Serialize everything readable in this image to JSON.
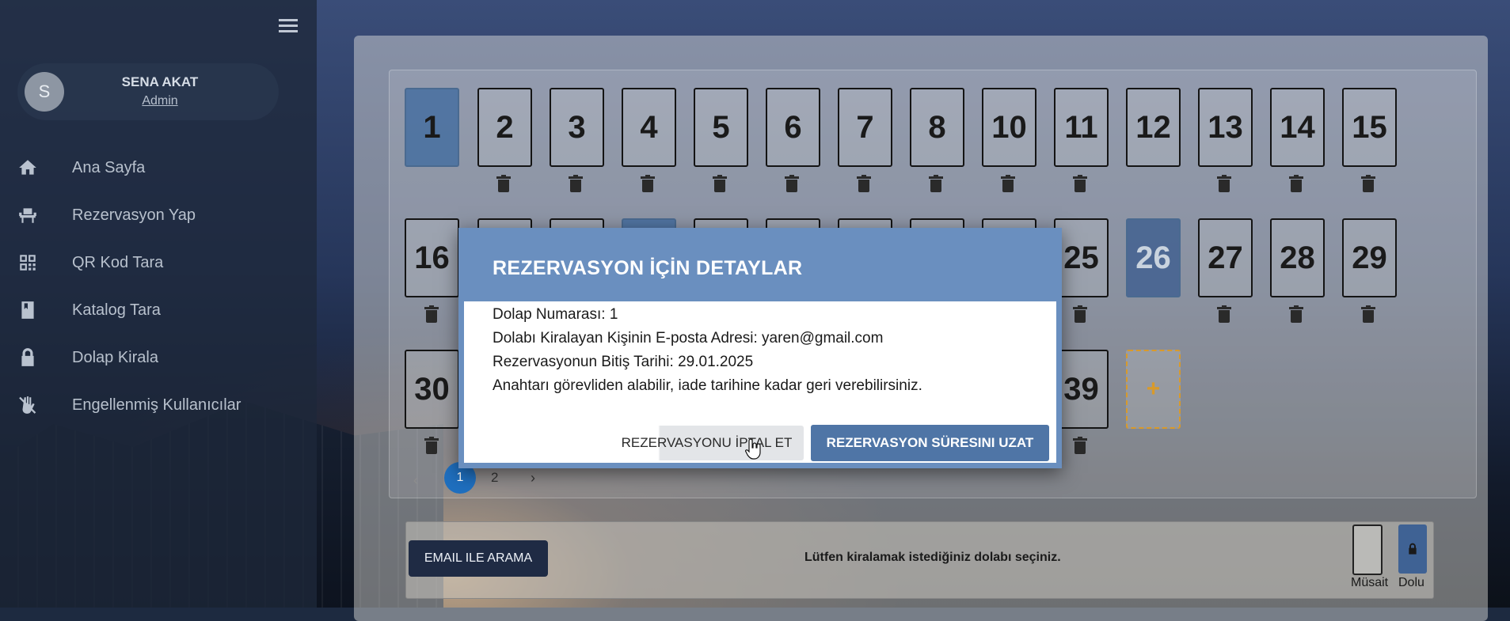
{
  "sidebar": {
    "user": {
      "initial": "S",
      "name": "SENA AKAT",
      "role": "Admin"
    },
    "items": [
      {
        "label": "Ana Sayfa",
        "icon": "home-icon"
      },
      {
        "label": "Rezervasyon Yap",
        "icon": "seat-icon"
      },
      {
        "label": "QR Kod Tara",
        "icon": "qr-code-icon"
      },
      {
        "label": "Katalog Tara",
        "icon": "book-icon"
      },
      {
        "label": "Dolap Kirala",
        "icon": "lock-icon"
      },
      {
        "label": "Engellenmiş Kullanıcılar",
        "icon": "blocked-hand-icon"
      }
    ]
  },
  "lockers": {
    "row1": [
      "1",
      "2",
      "3",
      "4",
      "5",
      "6",
      "7",
      "8",
      "10",
      "11",
      "12",
      "13",
      "14",
      "15"
    ],
    "row2_visible": [
      "16",
      "25",
      "26",
      "27",
      "28",
      "29"
    ],
    "row3_visible": [
      "30",
      "39"
    ],
    "add_label": "+",
    "selected": [
      "1",
      "26"
    ]
  },
  "pagination": {
    "prev": "‹",
    "pages": [
      "1",
      "2"
    ],
    "current": "1",
    "next": "›"
  },
  "bottom": {
    "email_button": "EMAIL ILE ARAMA",
    "message": "Lütfen kiralamak istediğiniz dolabı seçiniz.",
    "legend_free": "Müsait",
    "legend_full": "Dolu"
  },
  "modal": {
    "title": "REZERVASYON İÇİN DETAYLAR",
    "lines": [
      "Dolap Numarası: 1",
      "Dolabı Kiralayan Kişinin E-posta Adresi: yaren@gmail.com",
      "Rezervasyonun Bitiş Tarihi: 29.01.2025",
      "Anahtarı görevliden alabilir, iade tarihine kadar geri verebilirsiniz."
    ],
    "cancel_button": "REZERVASYONU İPTAL ET",
    "extend_button": "REZERVASYON SÜRESINI UZAT"
  },
  "colors": {
    "modal_header": "#6a8fbf",
    "extend_button": "#4f75a6",
    "pagination_active": "#1f6fbf",
    "add_locker": "#d99a2a",
    "sidebar_bg": "#1d283a"
  }
}
